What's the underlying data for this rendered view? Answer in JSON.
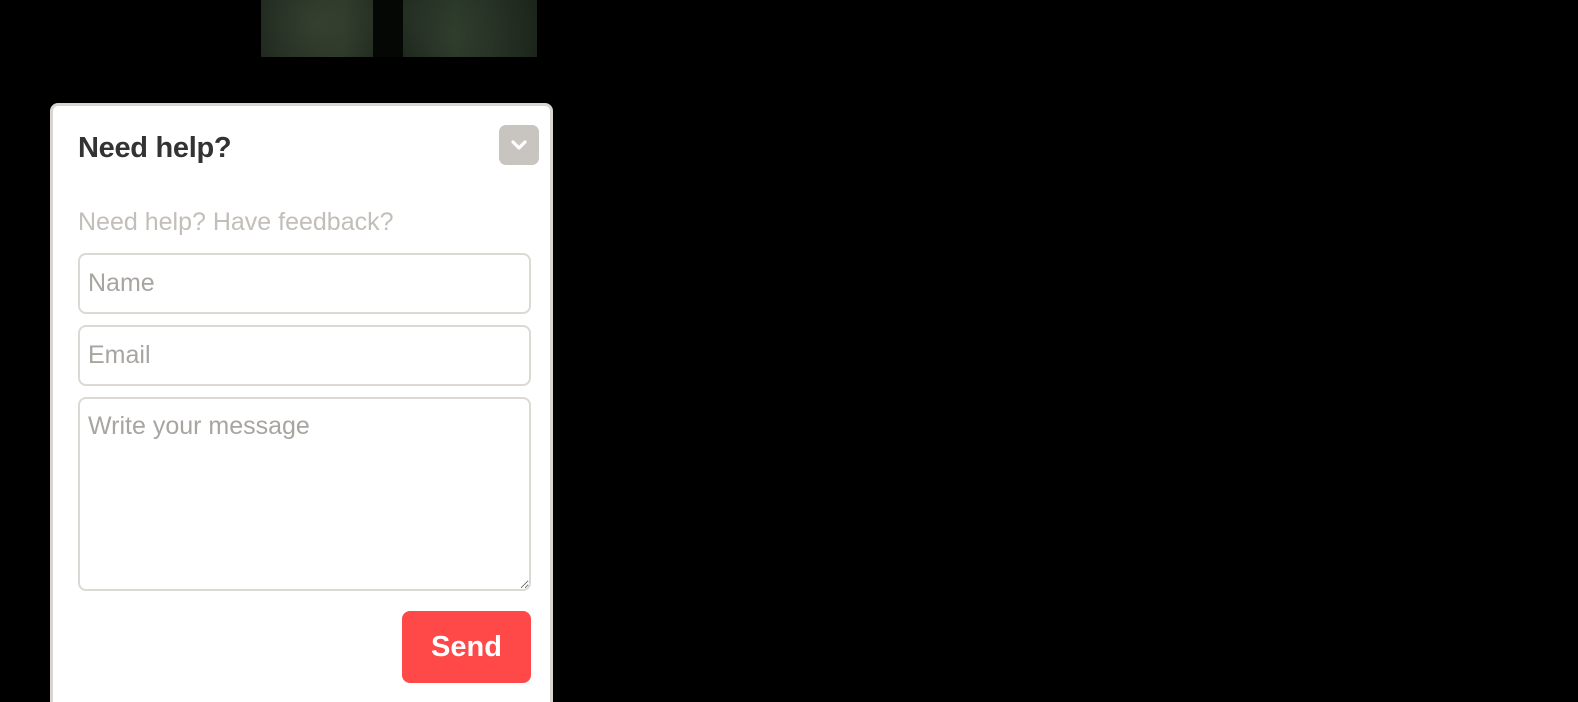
{
  "widget": {
    "title": "Need help?",
    "collapse_icon": "chevron-down-icon",
    "subtitle": "Need help? Have feedback?",
    "name_placeholder": "Name",
    "email_placeholder": "Email",
    "message_placeholder": "Write your message",
    "send_label": "Send"
  },
  "colors": {
    "page_background": "#000000",
    "send_button": "#ff4848",
    "collapse_button": "#c8c5c0",
    "title_text": "#333333",
    "subtitle_text": "#c2beb9"
  }
}
